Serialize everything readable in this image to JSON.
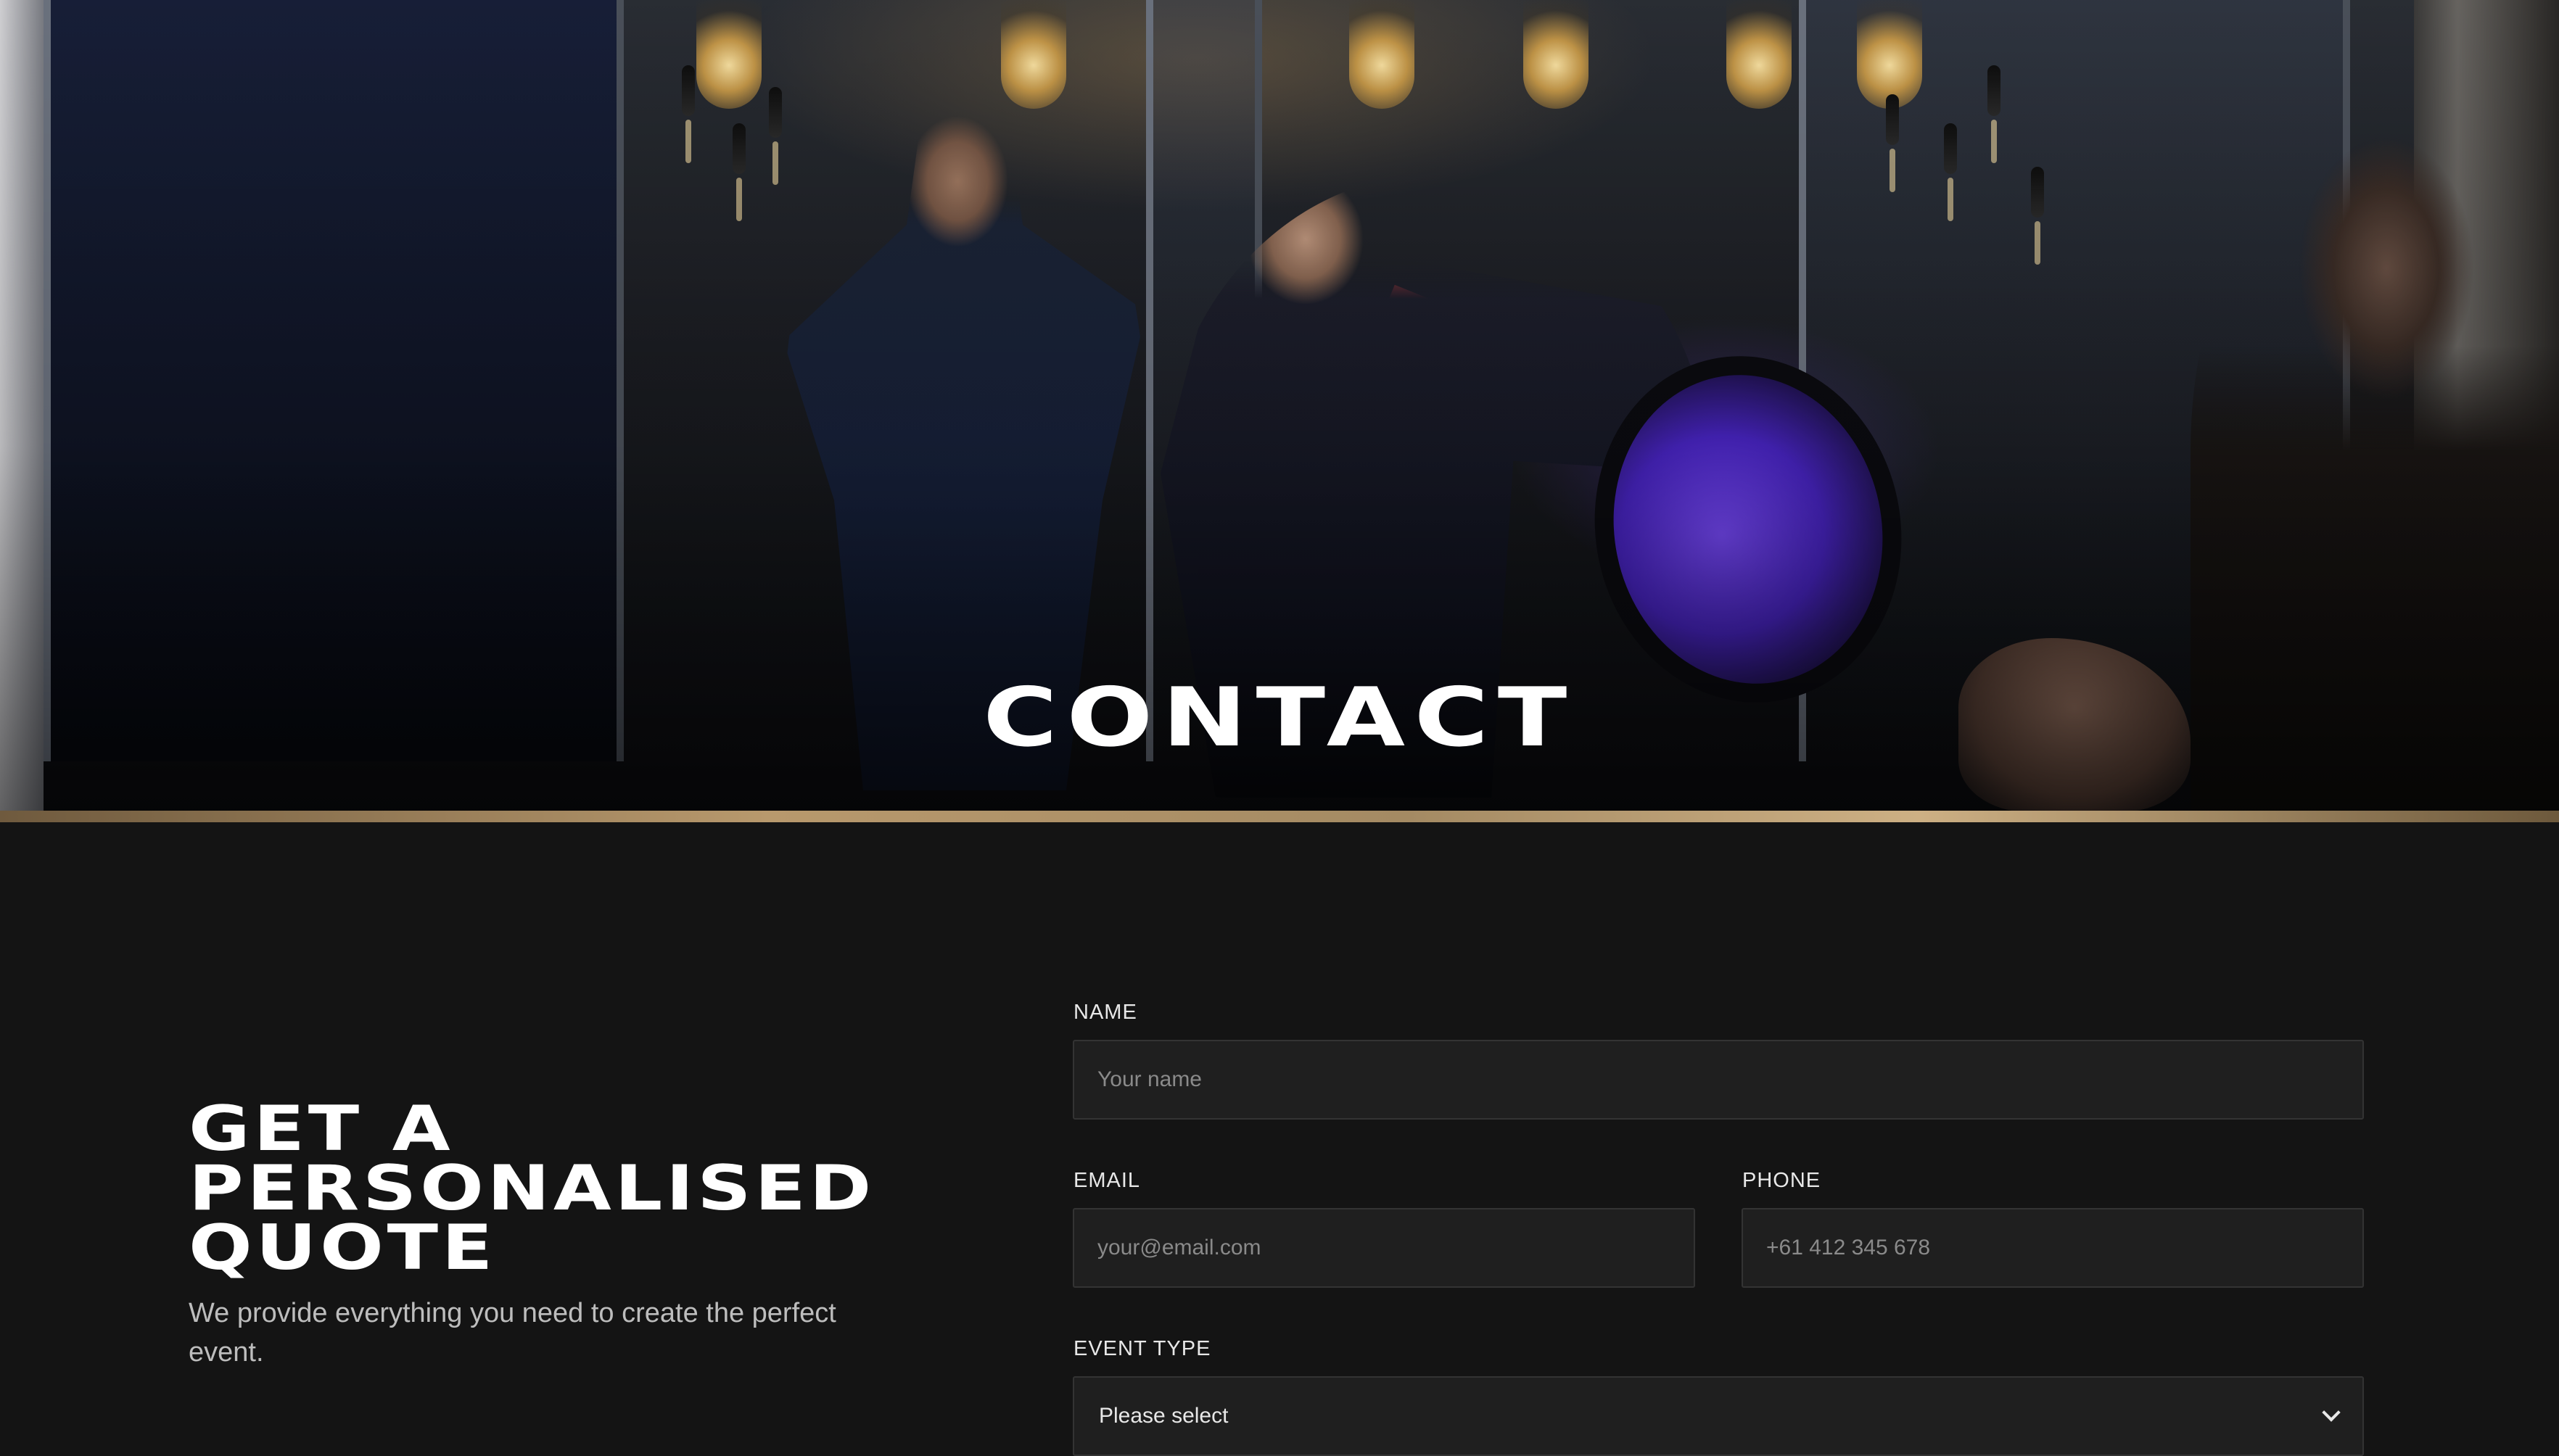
{
  "hero": {
    "title": "CONTACT"
  },
  "quote": {
    "heading_line1": "GET A",
    "heading_line2": "PERSONALISED",
    "heading_line3": "QUOTE",
    "subtitle": "We provide everything you need to create the perfect event."
  },
  "form": {
    "name": {
      "label": "NAME",
      "placeholder": "Your name"
    },
    "email": {
      "label": "EMAIL",
      "placeholder": "your@email.com"
    },
    "phone": {
      "label": "PHONE",
      "placeholder": "+61 412 345 678"
    },
    "event_type": {
      "label": "EVENT TYPE",
      "selected": "Please select",
      "icon": "chevron-down-icon"
    }
  },
  "colors": {
    "background": "#141414",
    "field_background": "#1f1f1f",
    "field_border": "#333333",
    "accent_gold": "#b8996d",
    "text_primary": "#ffffff",
    "text_muted": "#bdbdbd"
  }
}
